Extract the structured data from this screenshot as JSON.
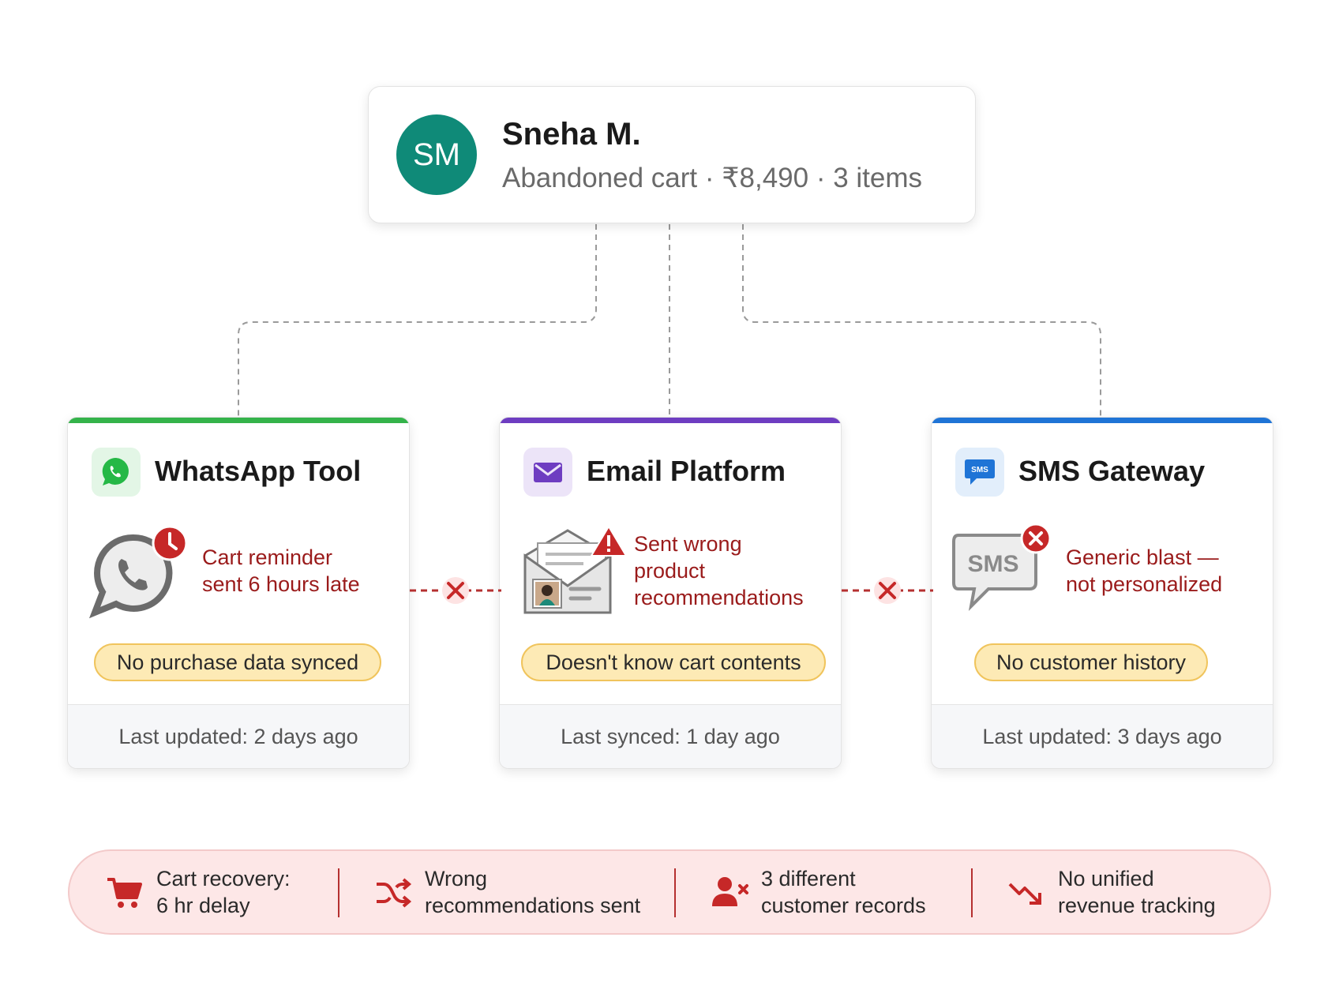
{
  "customer": {
    "initials": "SM",
    "name": "Sneha M.",
    "summary": "Abandoned cart · ₹8,490 · 3 items",
    "avatar_color": "#0f8a78"
  },
  "tools": [
    {
      "title": "WhatsApp Tool",
      "icon": "whatsapp-icon",
      "accent_color": "#34b34a",
      "issue_icon": "clock-alert-icon",
      "issue": "Cart reminder\nsent 6 hours late",
      "pill": "No purchase data synced",
      "footer": "Last updated: 2 days ago"
    },
    {
      "title": "Email Platform",
      "icon": "envelope-icon",
      "accent_color": "#6e3dc1",
      "issue_icon": "warning-icon",
      "issue": "Sent wrong\nproduct\nrecommendations",
      "pill": "Doesn't know cart contents",
      "footer": "Last synced: 1 day ago"
    },
    {
      "title": "SMS Gateway",
      "icon": "sms-icon",
      "accent_color": "#1f74d6",
      "issue_icon": "error-x-icon",
      "sms_bubble_label": "SMS",
      "sms_badge_label": "SMS",
      "issue": "Generic blast —\nnot personalized",
      "pill": "No customer history",
      "footer": "Last updated: 3 days ago"
    }
  ],
  "summary": [
    {
      "icon": "cart-icon",
      "text": "Cart recovery:\n6 hr delay"
    },
    {
      "icon": "shuffle-icon",
      "text": "Wrong\nrecommendations sent"
    },
    {
      "icon": "user-remove-icon",
      "text": "3 different\ncustomer records"
    },
    {
      "icon": "trend-down-icon",
      "text": "No unified\nrevenue tracking"
    }
  ],
  "colors": {
    "alert_red": "#c62828",
    "issue_text": "#9a1b1b",
    "pill_fill": "#fdeab5",
    "pill_border": "#f0c45c",
    "summary_fill": "#fde7e7"
  }
}
